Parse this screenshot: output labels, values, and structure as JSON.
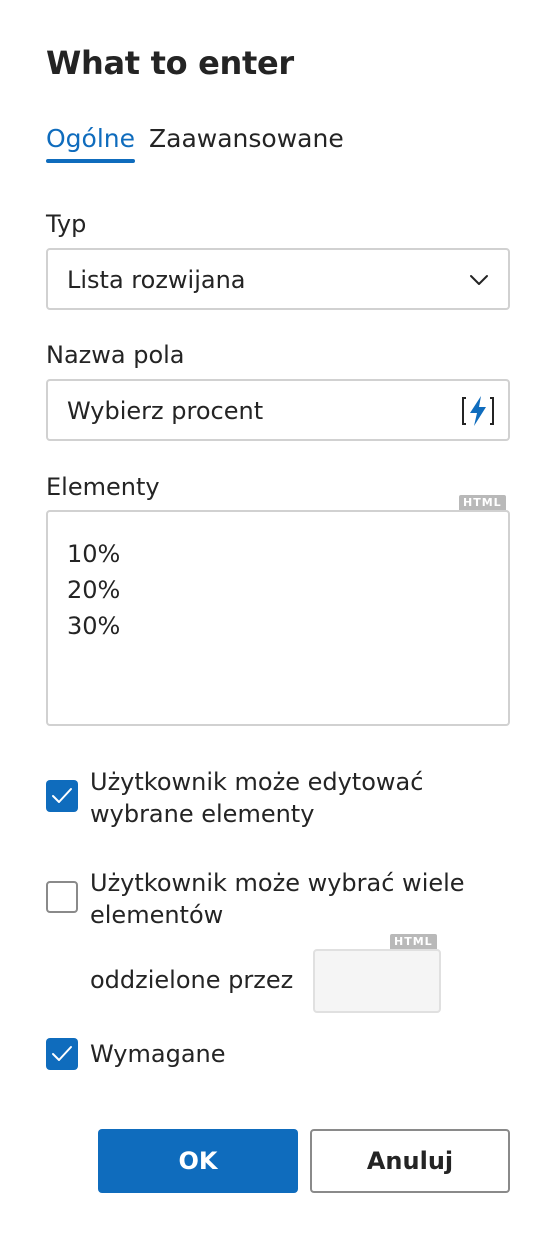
{
  "dialog": {
    "title": "What to enter",
    "tabs": [
      {
        "label": "Ogólne",
        "active": true
      },
      {
        "label": "Zaawansowane",
        "active": false
      }
    ]
  },
  "type_field": {
    "label": "Typ",
    "value": "Lista rozwijana",
    "icon": "chevron-down-icon"
  },
  "name_field": {
    "label": "Nazwa pola",
    "value": "Wybierz procent",
    "icon": "lightning-bracket-icon"
  },
  "elements_field": {
    "label": "Elementy",
    "badge": "HTML",
    "items": [
      "10%",
      "20%",
      "30%"
    ]
  },
  "options": {
    "editable": {
      "label": "Użytkownik może edytować wybrane elementy",
      "checked": true
    },
    "multiple": {
      "label": "Użytkownik może wybrać wiele elementów",
      "checked": false
    },
    "separator_label": "oddzielone przez",
    "separator_badge": "HTML",
    "separator_value": "",
    "required": {
      "label": "Wymagane",
      "checked": true
    }
  },
  "buttons": {
    "ok": "OK",
    "cancel": "Anuluj"
  },
  "colors": {
    "accent": "#0f6cbd",
    "text": "#242424",
    "border": "#d1d1d1"
  }
}
